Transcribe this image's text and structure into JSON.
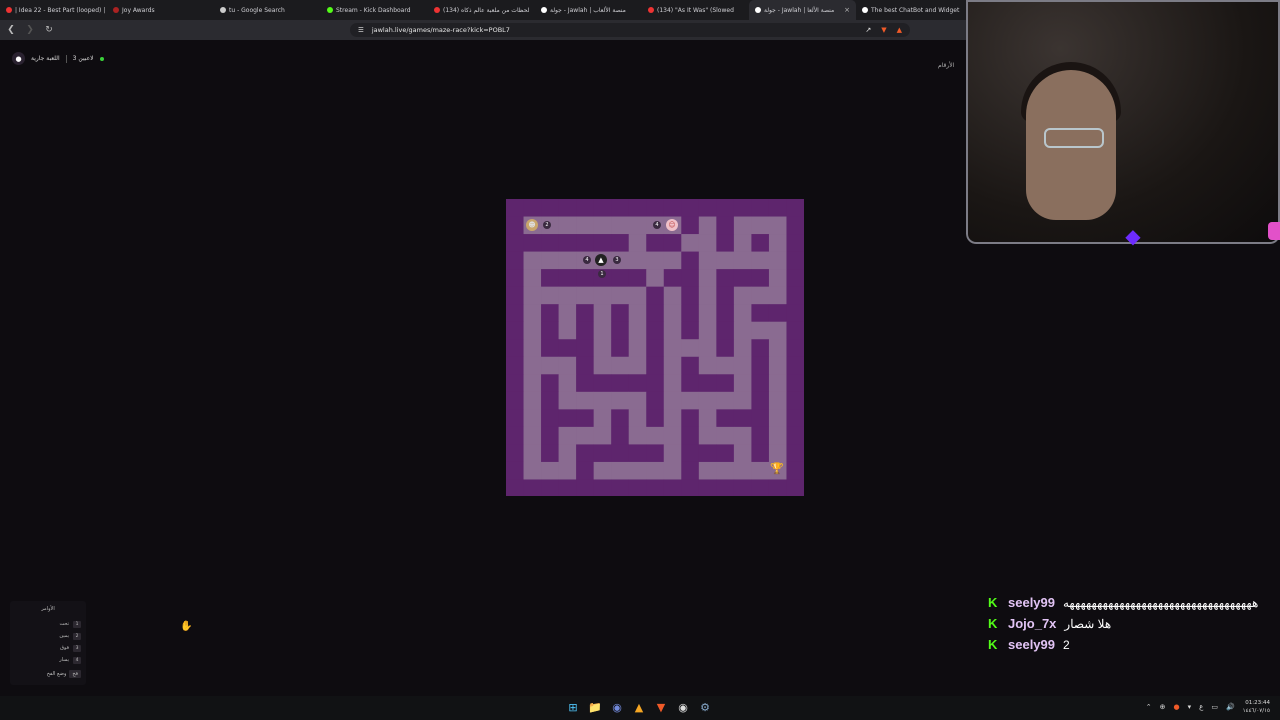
{
  "tabs": [
    {
      "label": "| Idea 22 - Best Part (looped) |",
      "color": "#e33"
    },
    {
      "label": "Joy Awards",
      "color": "#a22"
    },
    {
      "label": "tu - Google Search",
      "color": "#ccc"
    },
    {
      "label": "Stream - Kick Dashboard",
      "color": "#53fc18"
    },
    {
      "label": "(134) لحظات من ملعبة عالم ذكاه",
      "color": "#e33"
    },
    {
      "label": "جولة - Jawlah | منصة الألعاب",
      "color": "#fff"
    },
    {
      "label": "(134) \"As It Was\" (Slowed",
      "color": "#e33"
    },
    {
      "label": "جولة - Jawlah | منصة الألعا",
      "color": "#fff",
      "active": true
    },
    {
      "label": "The best ChatBot and Widget",
      "color": "#fff"
    }
  ],
  "toolbar": {
    "url": "jawlah.live/games/maze-race?kick=POBL7"
  },
  "page": {
    "players_count": "3 لاعبين",
    "game_status": "اللعبة جارية",
    "top_right_label": "الأرقام"
  },
  "maze": {
    "player_labels": [
      "2",
      "4",
      "4",
      "3",
      "1"
    ]
  },
  "commands": {
    "title": "الأوامر",
    "rows": [
      {
        "label": "تحت",
        "key": "1"
      },
      {
        "label": "يمين",
        "key": "2"
      },
      {
        "label": "فوق",
        "key": "3"
      },
      {
        "label": "يسار",
        "key": "4"
      }
    ],
    "footer_label": "وضع الفخ",
    "footer_key": "فخ"
  },
  "chat": [
    {
      "user": "seely99",
      "text": "ههههههههههههههههههههههههههههههههههه"
    },
    {
      "user": "Jojo_7x",
      "text": "هلا شصار"
    },
    {
      "user": "seely99",
      "text": "2"
    }
  ],
  "taskbar": {
    "time": "01:23:44",
    "date": "١٤٤٦/٠٧/١٥"
  }
}
